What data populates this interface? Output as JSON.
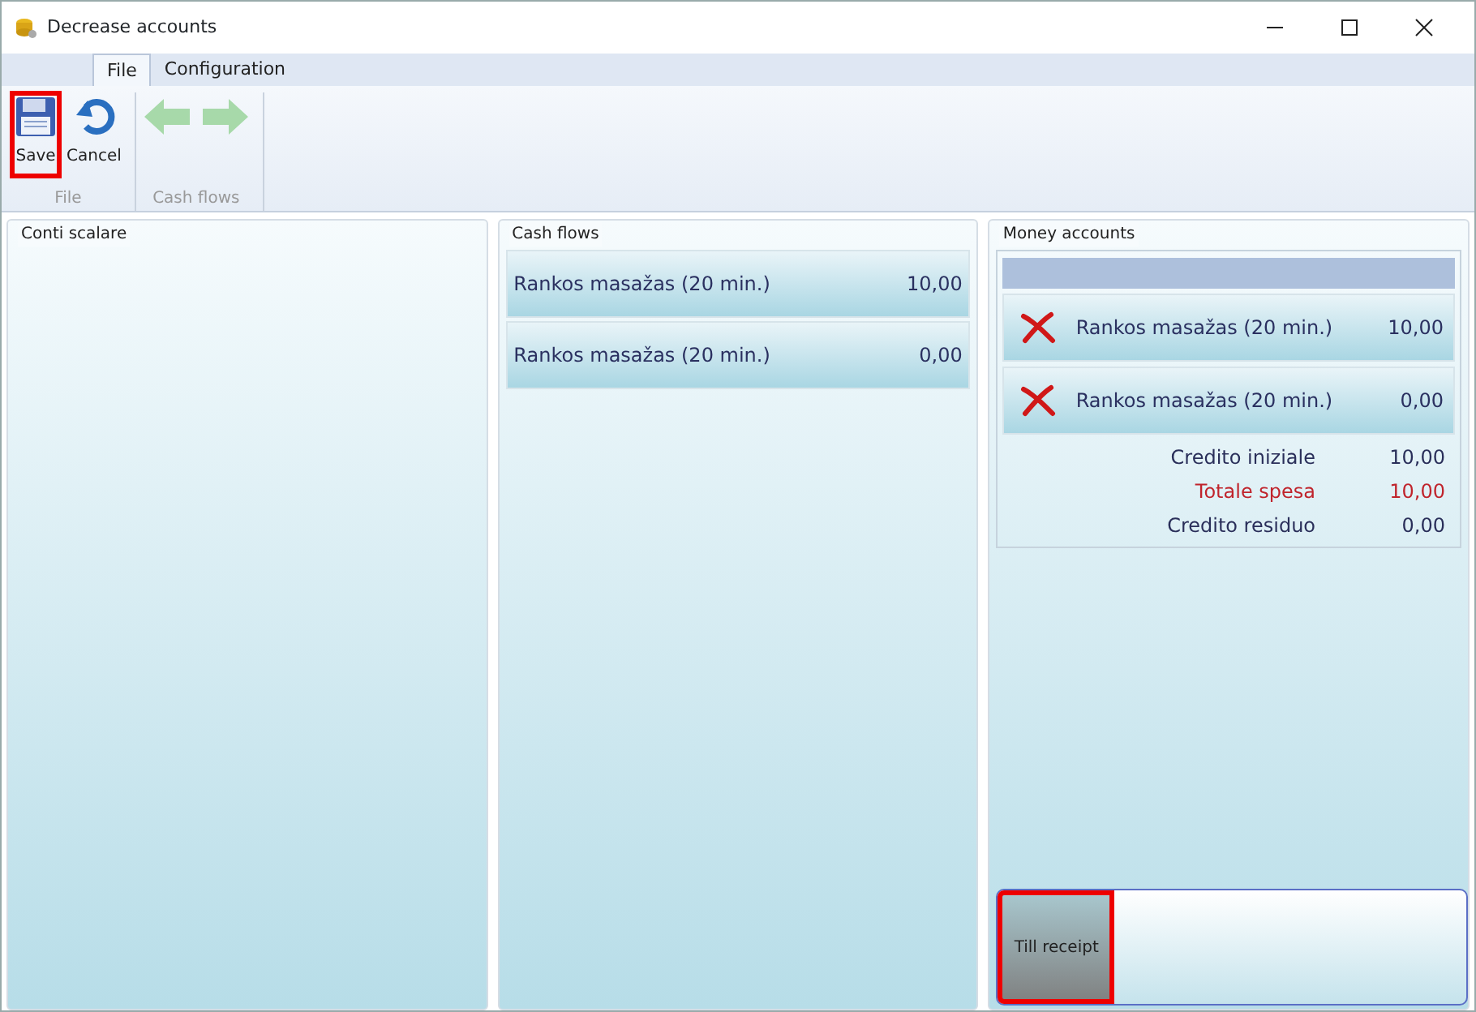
{
  "window": {
    "title": "Decrease accounts"
  },
  "tabs": [
    {
      "label": "File",
      "selected": true
    },
    {
      "label": "Configuration",
      "selected": false
    }
  ],
  "ribbon_groups": [
    {
      "label": "File",
      "buttons": [
        {
          "kind": "save",
          "label": "Save",
          "highlighted": true,
          "disabled": false
        },
        {
          "kind": "cancel",
          "label": "Cancel",
          "highlighted": false,
          "disabled": false
        }
      ]
    },
    {
      "label": "Cash flows",
      "buttons": [
        {
          "kind": "back",
          "disabled": true,
          "highlighted": false
        },
        {
          "kind": "forward",
          "disabled": true,
          "highlighted": false
        }
      ]
    }
  ],
  "conti_scalare": {
    "title": "Conti scalare"
  },
  "cash_flows": {
    "title": "Cash flows",
    "items": [
      {
        "name": "Rankos masažas (20 min.)",
        "amount": "10,00"
      },
      {
        "name": "Rankos masažas (20 min.)",
        "amount": "0,00"
      }
    ]
  },
  "money_accounts": {
    "title": "Money accounts",
    "items": [
      {
        "name": "Rankos masažas (20 min.)",
        "amount": "10,00"
      },
      {
        "name": "Rankos masažas (20 min.)",
        "amount": "0,00"
      }
    ],
    "totals": [
      {
        "label": "Credito iniziale",
        "value": "10,00",
        "color": "#2a2f5a"
      },
      {
        "label": "Totale spesa",
        "value": "10,00",
        "color": "#c0242c"
      },
      {
        "label": "Credito residuo",
        "value": "0,00",
        "color": "#2a2f5a"
      }
    ]
  },
  "till_receipt": {
    "label": "Till receipt",
    "highlighted": true
  }
}
